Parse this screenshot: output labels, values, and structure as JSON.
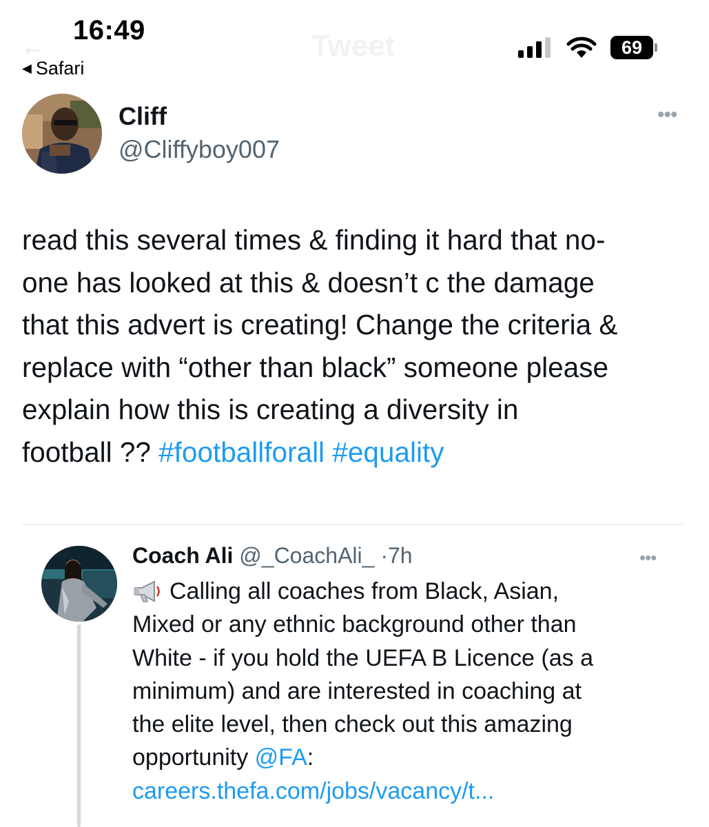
{
  "status_bar": {
    "time": "16:49",
    "back_app": "Safari",
    "battery": "69"
  },
  "header": {
    "back_arrow": "←",
    "title": "Tweet"
  },
  "main_tweet": {
    "author_name": "Cliff",
    "handle": "@Cliffyboy007",
    "more_icon": "•••",
    "text_lines": [
      "read this several times & finding it hard that no-",
      "one has looked at this & doesn’t c the damage",
      "that this advert is creating! Change the criteria &",
      "replace with “other than black” someone please",
      "explain how this is creating a diversity in"
    ],
    "last_line_text": "football ?? ",
    "hashtags": [
      "#footballforall",
      "#equality"
    ]
  },
  "quoted_tweet": {
    "author_name": "Coach Ali",
    "handle": "@_CoachAli_",
    "separator": "·",
    "time": "7h",
    "more_icon": "•••",
    "first_line": "Calling all coaches from Black, Asian,",
    "text_lines": [
      "Mixed or any ethnic background other than",
      "White - if you hold the UEFA B Licence (as a",
      "minimum) and are interested in coaching at",
      "the elite level, then check out this amazing"
    ],
    "mention_line_prefix": "opportunity ",
    "mention": "@FA",
    "mention_suffix": ":",
    "link": "careers.thefa.com/jobs/vacancy/t..."
  },
  "colors": {
    "link_blue": "#1d9bf0",
    "secondary_text": "#536471",
    "divider": "#eff3f4",
    "thread_line": "#cfd9de"
  },
  "icons": {
    "signal": "cellular-signal-icon",
    "wifi": "wifi-icon",
    "battery": "battery-icon",
    "megaphone": "megaphone-icon",
    "more": "more-options-icon"
  }
}
